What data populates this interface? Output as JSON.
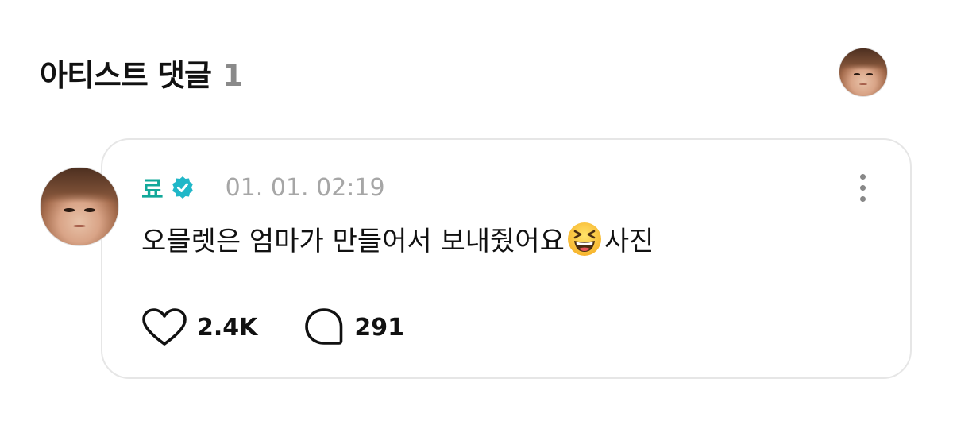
{
  "header": {
    "title": "아티스트 댓글",
    "count": "1"
  },
  "comment": {
    "author": "료",
    "timestamp": "01. 01. 02:19",
    "text_before_emoji": "오믈렛은 엄마가 만들어서 보내줬어요",
    "emoji": "grinning-squinting-face",
    "text_after_emoji": "사진",
    "likes": "2.4K",
    "replies": "291"
  },
  "colors": {
    "author": "#12a89a",
    "verified_badge": "#20b7c8",
    "timestamp": "#a6a6a6",
    "count_muted": "#8a8a8a",
    "card_border": "#e6e6e6"
  },
  "icons": {
    "verified": "verified-badge-icon",
    "more": "more-vertical-icon",
    "like": "heart-icon",
    "reply": "speech-bubble-icon"
  }
}
